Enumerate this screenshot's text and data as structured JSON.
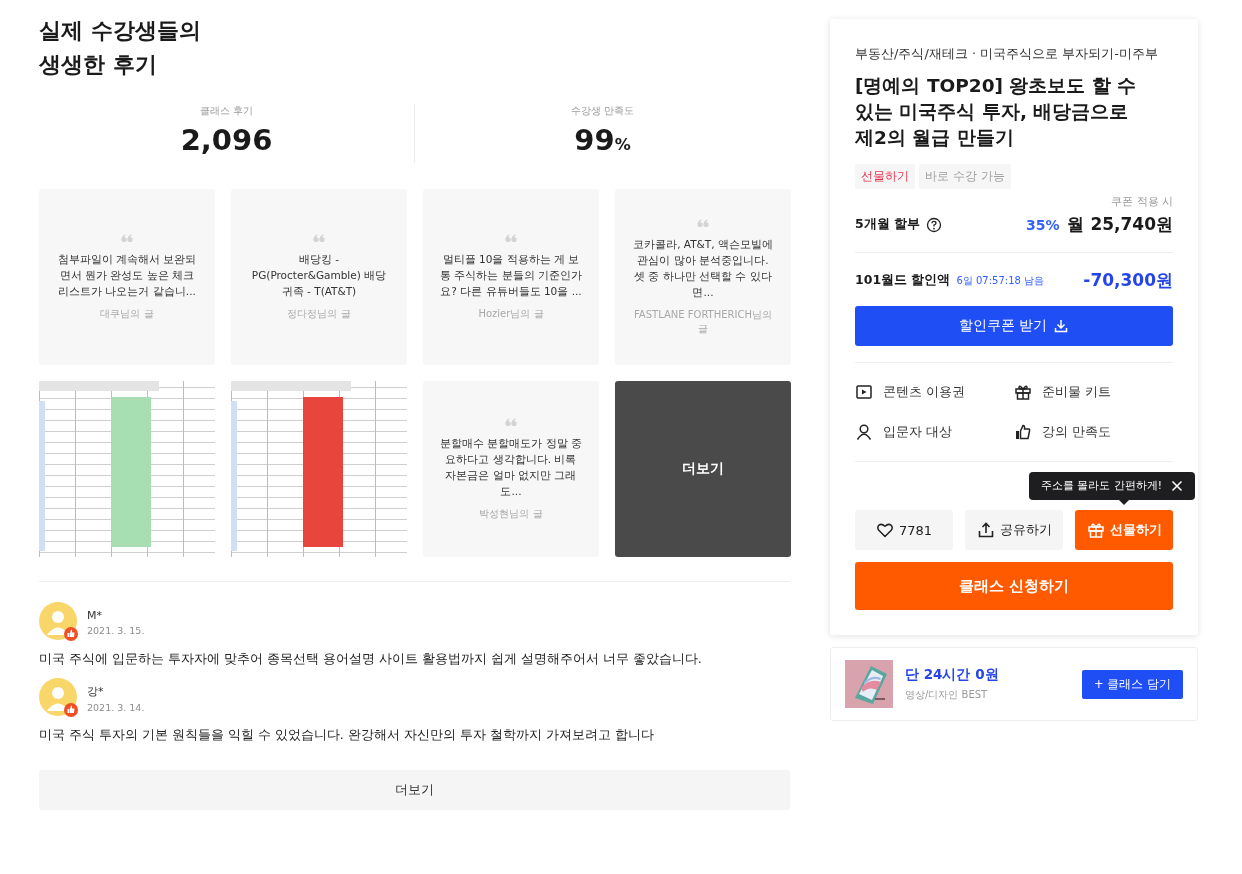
{
  "reviews_section": {
    "title_lines": [
      "실제 수강생들의",
      "생생한 후기"
    ],
    "stats": [
      {
        "label": "클래스 후기",
        "value": "2,096"
      },
      {
        "label": "수강생 만족도",
        "value": "99",
        "unit": "%"
      }
    ],
    "gallery": [
      {
        "kind": "quote",
        "text": "첨부파일이 계속해서 보완되면서 뭔가 완성도 높은 체크리스트가 나오는거 같습니...",
        "author": "대쿠님의 글"
      },
      {
        "kind": "quote",
        "text": "배당킹 - PG(Procter&Gamble) 배당귀족 - T(AT&T)",
        "author": "정다정님의 글"
      },
      {
        "kind": "quote",
        "text": "멀티플 10을 적용하는 게 보통 주식하는 분들의 기준인가요? 다른 유튜버들도 10을 ...",
        "author": "Hozier님의 글"
      },
      {
        "kind": "quote",
        "text": "코카콜라, AT&T, 액슨모빌에 관심이 많아 분석중입니다. 셋 중 하나만 선택할 수 있다면...",
        "author": "FASTLANE FORTHERICH님의 글"
      },
      {
        "kind": "sheet"
      },
      {
        "kind": "sheet"
      },
      {
        "kind": "quote",
        "text": "분할매수 분할매도가 정말 중요하다고 생각합니다. 비록 자본금은 얼마 없지만 그래도...",
        "author": "박성현님의 글"
      },
      {
        "kind": "more",
        "label": "더보기"
      }
    ],
    "reviews": [
      {
        "name": "M*",
        "date": "2021. 3. 15.",
        "text": "미국 주식에 입문하는 투자자에 맞추어 종목선택 용어설명 사이트 활용법까지 쉽게 설명해주어서 너무 좋았습니다."
      },
      {
        "name": "강*",
        "date": "2021. 3. 14.",
        "text": "미국 주식 투자의 기본 원칙들을 익힐 수 있었습니다. 완강해서 자신만의 투자 철학까지 가져보려고 합니다"
      }
    ],
    "more_button": "더보기"
  },
  "purchase_card": {
    "category": "부동산/주식/재테크 · 미국주식으로 부자되기-미주부",
    "title": "[명예의 TOP20] 왕초보도 할 수 있는 미국주식 투자, 배당금으로 제2의 월급 만들기",
    "tags": [
      {
        "label": "선물하기",
        "color": "#e8344e"
      },
      {
        "label": "바로 수강 가능",
        "color": "#a0a0a0"
      }
    ],
    "coupon_note": "쿠폰 적용 시",
    "installment": {
      "label": "5개월 할부",
      "discount": "35%",
      "price": "월 25,740원"
    },
    "discount": {
      "label": "101월드 할인액",
      "timer": "6일 07:57:18 남음",
      "amount": "-70,300원"
    },
    "coupon_button": "할인쿠폰 받기",
    "features": [
      {
        "kind": "video",
        "label": "콘텐츠 이용권"
      },
      {
        "kind": "gift",
        "label": "준비물 키트"
      },
      {
        "kind": "person",
        "label": "입문자 대상"
      },
      {
        "kind": "thumb",
        "label": "강의 만족도"
      }
    ],
    "tooltip": "주소를 몰라도 간편하게!",
    "actions": [
      {
        "kind": "like",
        "label": "7781"
      },
      {
        "kind": "share",
        "label": "공유하기"
      },
      {
        "kind": "gift",
        "label": "선물하기"
      }
    ],
    "apply_button": "클래스 신청하기"
  },
  "promo": {
    "title": "단 24시간 0원",
    "subtitle": "영상/디자인 BEST",
    "button": "+ 클래스 담기"
  }
}
